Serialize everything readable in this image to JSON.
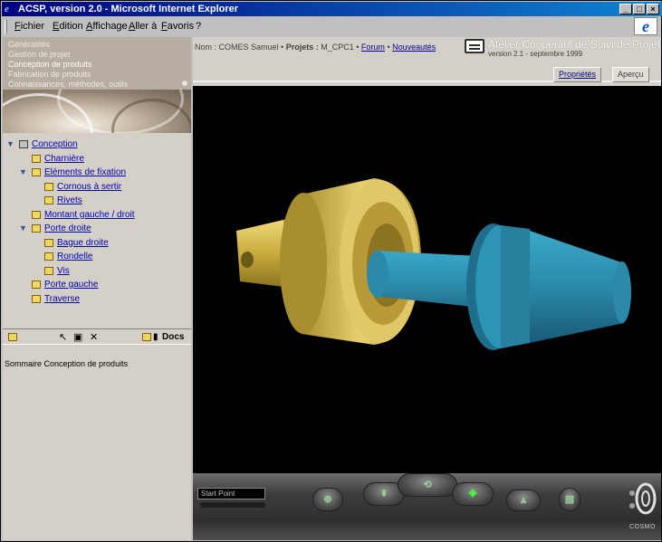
{
  "window": {
    "title": "ACSP, version 2.0 - Microsoft Internet Explorer",
    "controls": [
      "_",
      "□",
      "×"
    ]
  },
  "menu": [
    "Fichier",
    "Edition",
    "Affichage",
    "Aller à",
    "Favoris",
    "?"
  ],
  "nav": {
    "links": [
      "Généralités",
      "Gestion de projet",
      "Conception de produits",
      "Fabrication de produits",
      "Connaissances, méthodes, outils"
    ],
    "active_index": 2
  },
  "tree": [
    {
      "label": "Conception",
      "depth": 0,
      "expanded": true,
      "icon": "node-icon"
    },
    {
      "label": "Charnière",
      "depth": 1,
      "expanded": null
    },
    {
      "label": "Eléments de fixation",
      "depth": 1,
      "expanded": true
    },
    {
      "label": "Cornous à sertir",
      "depth": 2,
      "expanded": null
    },
    {
      "label": "Rivets",
      "depth": 2,
      "expanded": null
    },
    {
      "label": "Montant gauche / droit",
      "depth": 1,
      "expanded": null
    },
    {
      "label": "Porte droite",
      "depth": 1,
      "expanded": true
    },
    {
      "label": "Bague droite",
      "depth": 2,
      "expanded": null
    },
    {
      "label": "Rondelle",
      "depth": 2,
      "expanded": null
    },
    {
      "label": "Vis",
      "depth": 2,
      "expanded": null
    },
    {
      "label": "Porte gauche",
      "depth": 1,
      "expanded": null
    },
    {
      "label": "Traverse",
      "depth": 1,
      "expanded": null
    }
  ],
  "tree_toolbar": {
    "docs_label": "Docs"
  },
  "summary_text": "Sommaire Conception de produits",
  "breadcrumb": {
    "user": "Nom : COMES Samuel",
    "projects_label": "Projets :",
    "project": "M_CPC1",
    "forum": "Forum",
    "news": "Nouveautés"
  },
  "app": {
    "title": "Atelier Coopératif de Suivi de Projet",
    "version": "version 2.1 - septembre 1999"
  },
  "tabs": [
    {
      "label": "Propriétés",
      "active": false
    },
    {
      "label": "Aperçu",
      "active": true
    }
  ],
  "viewer": {
    "camera_label": "Start Point",
    "brand": "COSMO",
    "colors": {
      "gold_part": "#c8b040",
      "blue_part": "#2a8aa8",
      "background": "#000000"
    }
  }
}
